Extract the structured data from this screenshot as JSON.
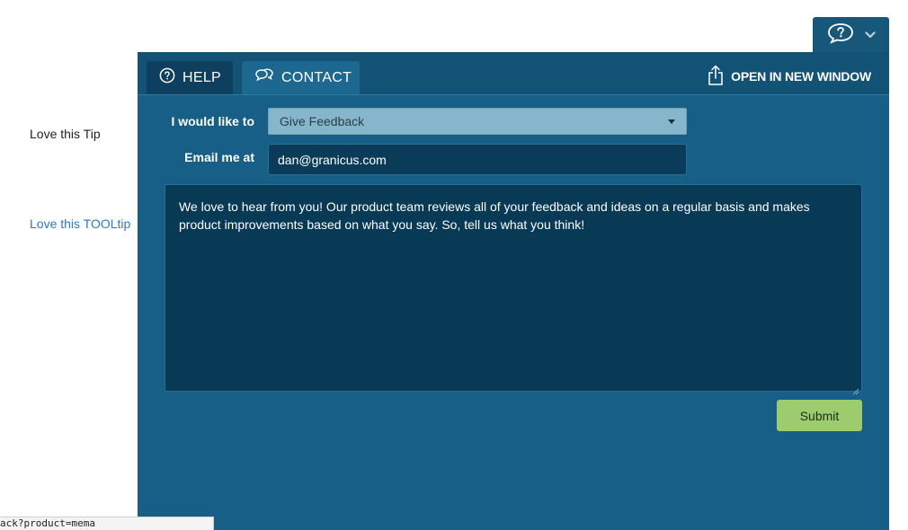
{
  "left_links": {
    "tip": "Love this Tip",
    "tooltip": "Love this TOOLtip"
  },
  "toggle": {
    "icon": "speech-question-icon",
    "chevron": "chevron-down-icon"
  },
  "tabs": {
    "help_label": "HELP",
    "contact_label": "CONTACT"
  },
  "open_window_label": "OPEN IN NEW WINDOW",
  "form": {
    "intent_label": "I would like to",
    "intent_value": "Give Feedback",
    "email_label": "Email me at",
    "email_value": "dan@granicus.com",
    "message": "We love to hear from you! Our product team reviews all of your feedback and ideas on a regular basis and makes product improvements based on what you say. So, tell us what you think!",
    "submit_label": "Submit"
  },
  "status_url": "ack?product=mema",
  "colors": {
    "panel": "#175f86",
    "submit": "#9ccc6e",
    "link": "#2e78c7"
  }
}
